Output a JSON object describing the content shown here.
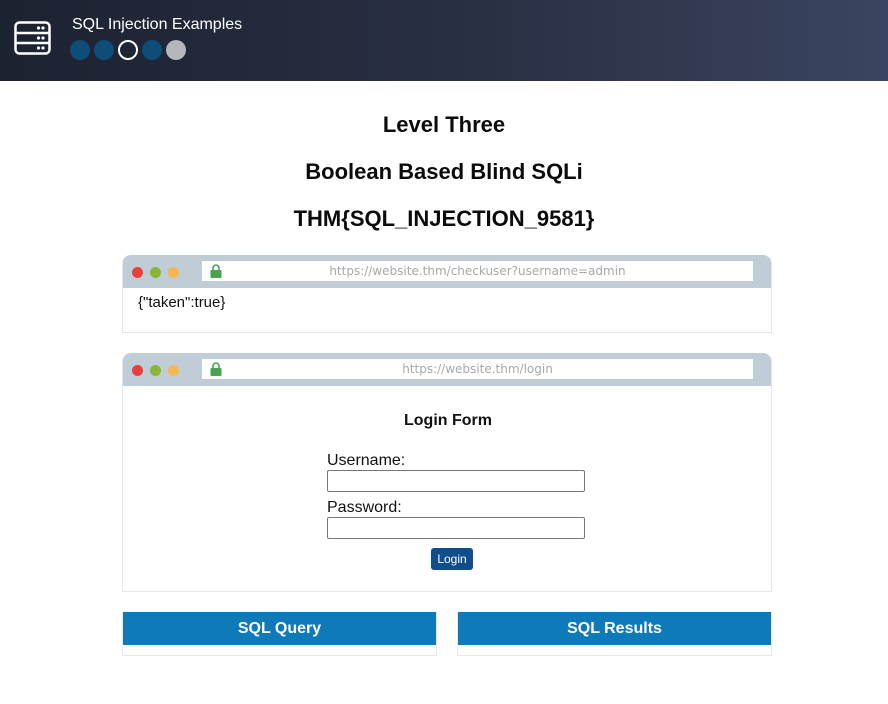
{
  "header": {
    "title": "SQL Injection Examples",
    "icon": "server-icon",
    "levels": [
      {
        "state": "done"
      },
      {
        "state": "done"
      },
      {
        "state": "current"
      },
      {
        "state": "done"
      },
      {
        "state": "locked"
      }
    ]
  },
  "level": {
    "name": "Level Three",
    "type": "Boolean Based Blind SQLi",
    "flag": "THM{SQL_INJECTION_9581}"
  },
  "api_window": {
    "url": "https://website.thm/checkuser?username=admin",
    "response": "{\"taken\":true}"
  },
  "login_window": {
    "url": "https://website.thm/login",
    "form_title": "Login Form",
    "username_label": "Username:",
    "username_value": "",
    "password_label": "Password:",
    "password_value": "",
    "login_label": "Login"
  },
  "panels": {
    "query_title": "SQL Query",
    "results_title": "SQL Results"
  },
  "colors": {
    "header_bg": "#2a3044",
    "dot_done": "#0d4d77",
    "dot_locked": "#b6b7bb",
    "panel_head": "#0f7ab8",
    "login_button": "#0f4d8d",
    "browser_bar": "#c0ccd6"
  }
}
